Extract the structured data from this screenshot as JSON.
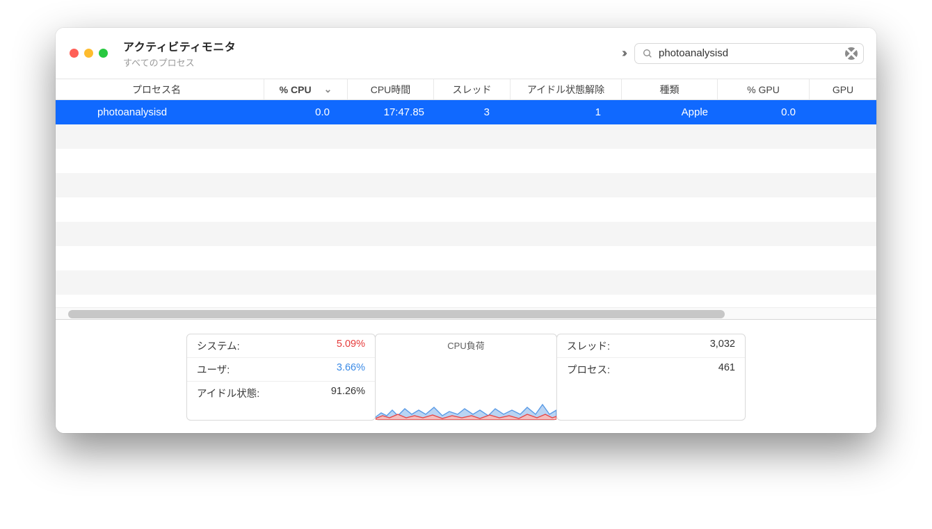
{
  "header": {
    "title": "アクティビティモニタ",
    "subtitle": "すべてのプロセス"
  },
  "search": {
    "value": "photoanalysisd"
  },
  "columns": {
    "name": "プロセス名",
    "cpu": "% CPU",
    "time": "CPU時間",
    "threads": "スレッド",
    "idle": "アイドル状態解除",
    "kind": "種類",
    "gpu": "% GPU",
    "gputime": "GPU"
  },
  "rows": [
    {
      "name": "photoanalysisd",
      "cpu": "0.0",
      "time": "17:47.85",
      "threads": "3",
      "idle": "1",
      "kind": "Apple",
      "gpu": "0.0"
    }
  ],
  "footer": {
    "system_label": "システム:",
    "system": "5.09%",
    "user_label": "ユーザ:",
    "user": "3.66%",
    "idle_label": "アイドル状態:",
    "idle": "91.26%",
    "chart_title": "CPU負荷",
    "threads_label": "スレッド:",
    "threads": "3,032",
    "procs_label": "プロセス:",
    "procs": "461"
  }
}
